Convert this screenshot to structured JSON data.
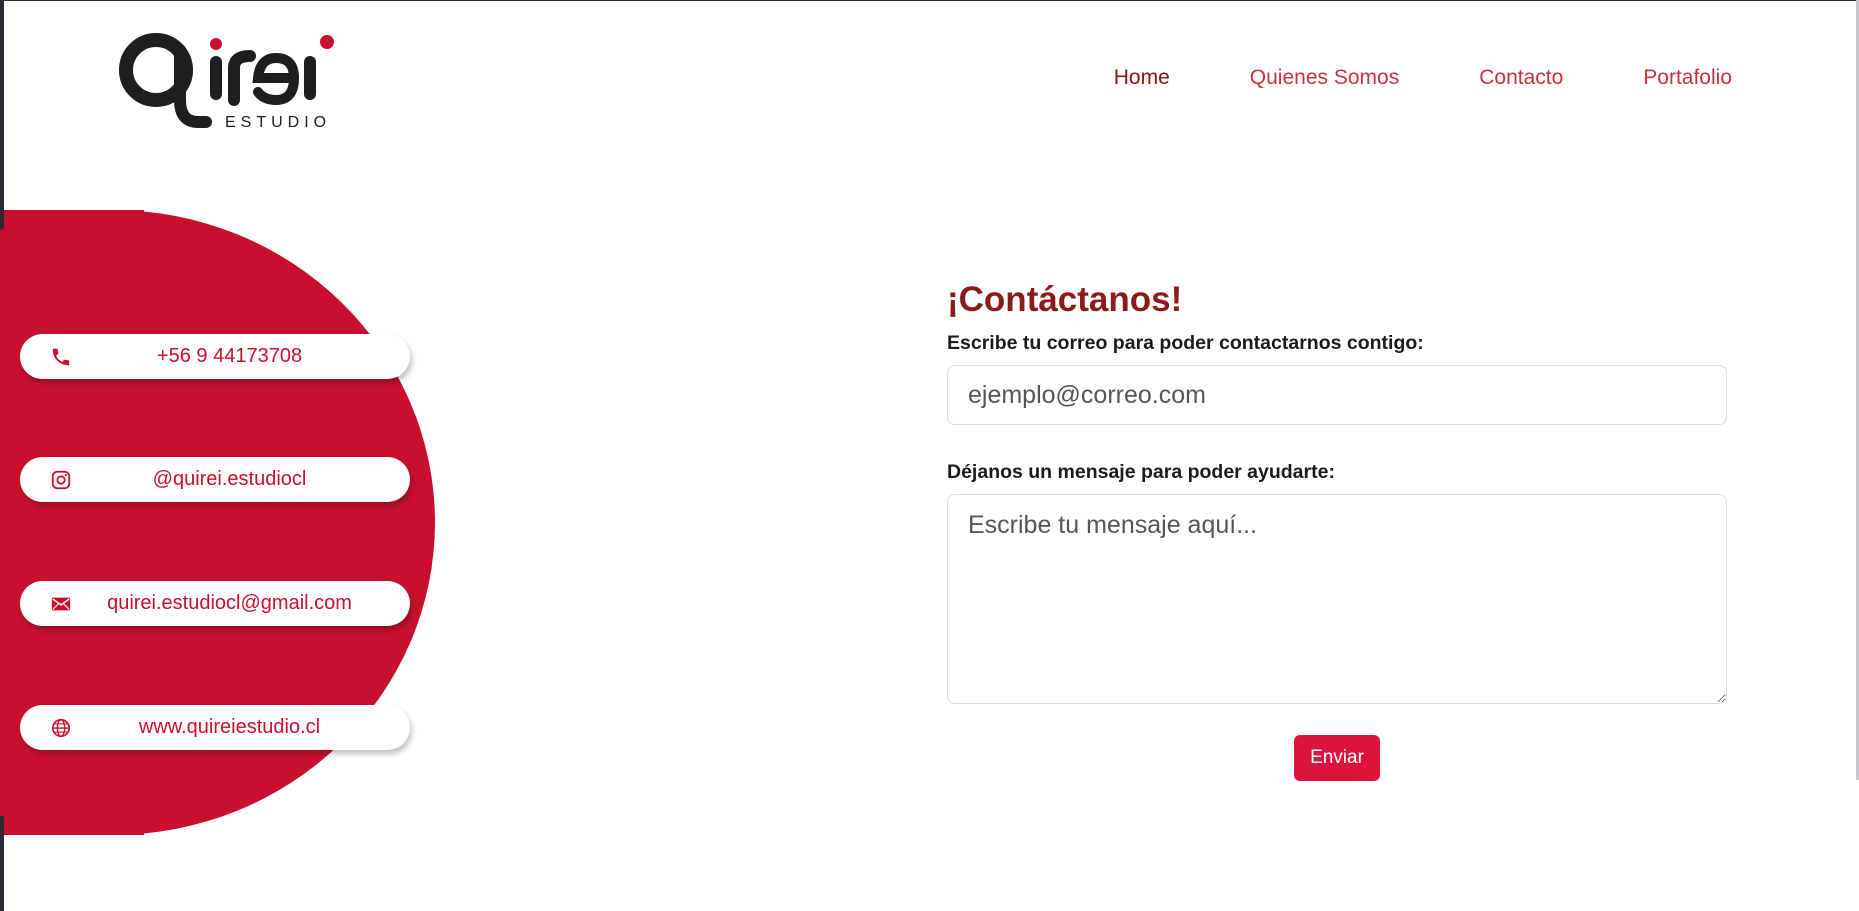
{
  "brand": {
    "logo_main": "Qjrei",
    "logo_sub": "ESTUDIO",
    "accent": "#c8102e",
    "dark": "#1e1e1e"
  },
  "nav": {
    "items": [
      {
        "label": "Home",
        "active": true
      },
      {
        "label": "Quienes Somos",
        "active": false
      },
      {
        "label": "Contacto",
        "active": false
      },
      {
        "label": "Portafolio",
        "active": false
      }
    ]
  },
  "contacts": [
    {
      "icon": "phone-icon",
      "label": "+56 9 44173708"
    },
    {
      "icon": "instagram-icon",
      "label": "@quirei.estudiocl"
    },
    {
      "icon": "mail-icon",
      "label": "quirei.estudiocl@gmail.com"
    },
    {
      "icon": "globe-icon",
      "label": "www.quireiestudio.cl"
    }
  ],
  "form": {
    "title": "¡Contáctanos!",
    "email_label": "Escribe tu correo para poder contactarnos contigo:",
    "email_placeholder": "ejemplo@correo.com",
    "message_label": "Déjanos un mensaje para poder ayudarte:",
    "message_placeholder": "Escribe tu mensaje aquí...",
    "submit_label": "Enviar"
  }
}
